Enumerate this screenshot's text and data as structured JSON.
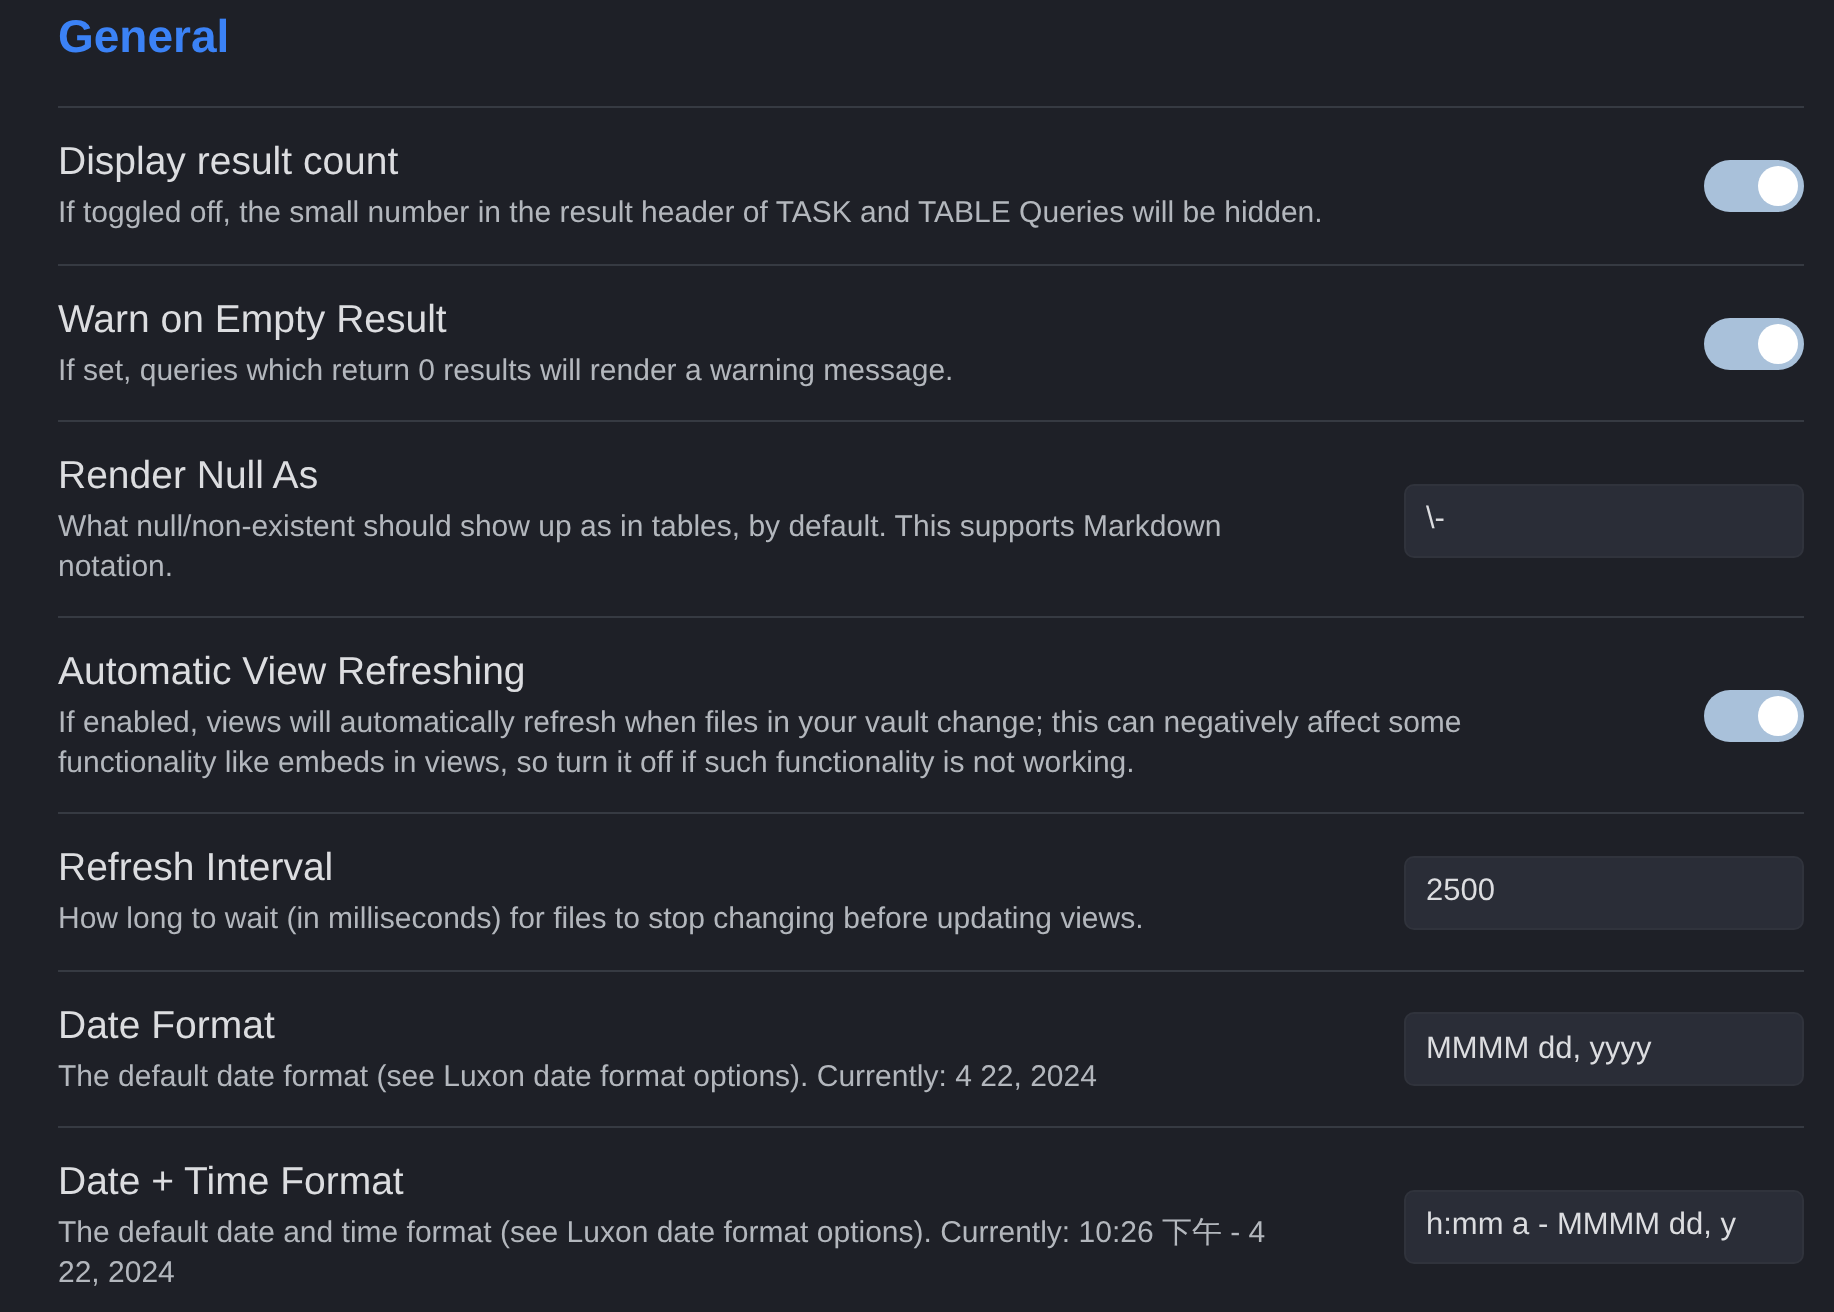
{
  "section": {
    "title": "General"
  },
  "settings": [
    {
      "kind": "toggle",
      "name": "Display result count",
      "description": "If toggled off, the small number in the result header of TASK and TABLE Queries will be hidden.",
      "on": true
    },
    {
      "kind": "toggle",
      "name": "Warn on Empty Result",
      "description": "If set, queries which return 0 results will render a warning message.",
      "on": true
    },
    {
      "kind": "text",
      "name": "Render Null As",
      "description": "What null/non-existent should show up as in tables, by default. This supports Markdown notation.",
      "value": "\\-"
    },
    {
      "kind": "toggle",
      "name": "Automatic View Refreshing",
      "description": "If enabled, views will automatically refresh when files in your vault change; this can negatively affect some functionality like embeds in views, so turn it off if such functionality is not working.",
      "on": true
    },
    {
      "kind": "text",
      "name": "Refresh Interval",
      "description": "How long to wait (in milliseconds) for files to stop changing before updating views.",
      "value": "2500"
    },
    {
      "kind": "text",
      "name": "Date Format",
      "description": "The default date format (see Luxon date format options). Currently: 4 22, 2024",
      "value": "MMMM dd, yyyy"
    },
    {
      "kind": "text",
      "name": "Date + Time Format",
      "description": "The default date and time format (see Luxon date format options). Currently: 10:26 下午 - 4 22, 2024",
      "value": "h:mm a - MMMM dd, y"
    }
  ]
}
